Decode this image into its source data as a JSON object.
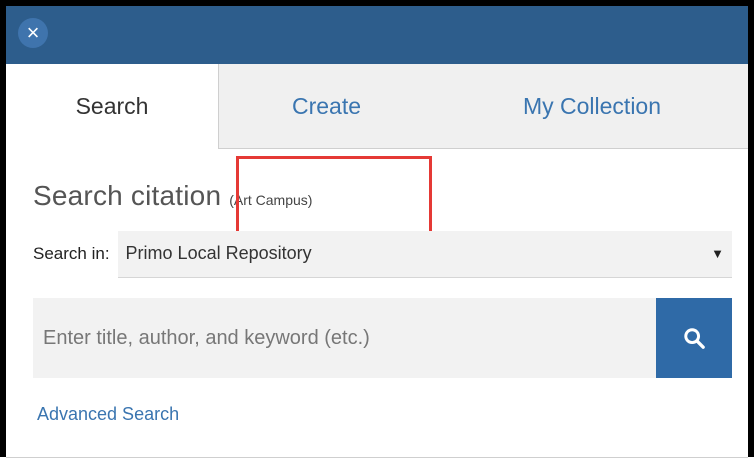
{
  "header": {
    "close_glyph": "×",
    "bar_color": "#2d5d8c"
  },
  "tabs": [
    {
      "label": "Search",
      "active": true
    },
    {
      "label": "Create",
      "active": false
    },
    {
      "label": "My Collection",
      "active": false
    }
  ],
  "citation": {
    "title": "Search citation",
    "scope": "(Art Campus)"
  },
  "search_in": {
    "label": "Search in:",
    "selected": "Primo Local Repository"
  },
  "search": {
    "placeholder": "Enter title, author, and keyword (etc.)"
  },
  "advanced_link": "Advanced Search",
  "colors": {
    "accent": "#3a75b0",
    "button": "#2f6aa7",
    "highlight": "#e53935"
  }
}
